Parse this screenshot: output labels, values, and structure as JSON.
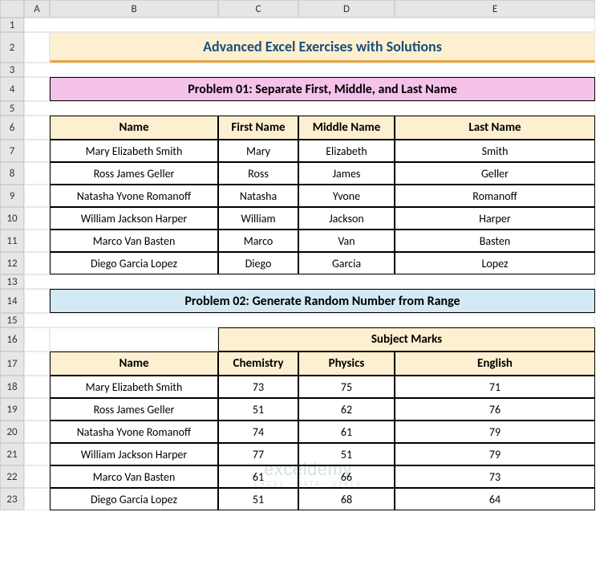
{
  "columns": [
    "",
    "A",
    "B",
    "C",
    "D",
    "E"
  ],
  "rows": [
    "1",
    "2",
    "3",
    "4",
    "5",
    "6",
    "7",
    "8",
    "9",
    "10",
    "11",
    "12",
    "13",
    "14",
    "15",
    "16",
    "17",
    "18",
    "19",
    "20",
    "21",
    "22",
    "23"
  ],
  "title": "Advanced Excel Exercises with Solutions",
  "problem1": {
    "heading": "Problem 01: Separate First, Middle, and Last Name",
    "headers": [
      "Name",
      "First Name",
      "Middle Name",
      "Last Name"
    ],
    "rows": [
      [
        "Mary Elizabeth Smith",
        "Mary",
        "Elizabeth",
        "Smith"
      ],
      [
        "Ross James Geller",
        "Ross",
        "James",
        "Geller"
      ],
      [
        "Natasha Yvone Romanoff",
        "Natasha",
        "Yvone",
        "Romanoff"
      ],
      [
        "William Jackson Harper",
        "William",
        "Jackson",
        "Harper"
      ],
      [
        "Marco Van Basten",
        "Marco",
        "Van",
        "Basten"
      ],
      [
        "Diego Garcia Lopez",
        "Diego",
        "Garcia",
        "Lopez"
      ]
    ]
  },
  "problem2": {
    "heading": "Problem 02: Generate Random Number from Range",
    "group_header": "Subject Marks",
    "headers": [
      "Name",
      "Chemistry",
      "Physics",
      "English"
    ],
    "rows": [
      [
        "Mary Elizabeth Smith",
        "73",
        "75",
        "71"
      ],
      [
        "Ross James Geller",
        "51",
        "62",
        "76"
      ],
      [
        "Natasha Yvone Romanoff",
        "74",
        "61",
        "79"
      ],
      [
        "William Jackson Harper",
        "77",
        "51",
        "79"
      ],
      [
        "Marco Van Basten",
        "61",
        "66",
        "73"
      ],
      [
        "Diego Garcia Lopez",
        "51",
        "68",
        "64"
      ]
    ]
  },
  "watermark": {
    "top": "exceldemy",
    "bot": "EXCEL · DATA · STATS"
  }
}
